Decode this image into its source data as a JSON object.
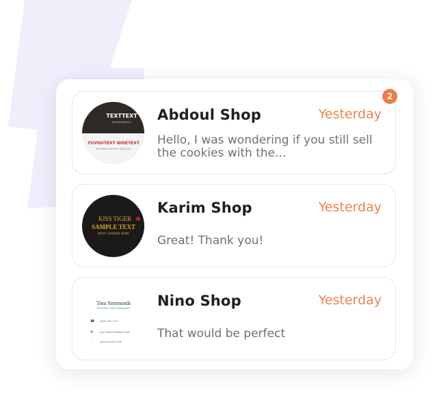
{
  "conversations": [
    {
      "name": "Abdoul Shop",
      "time": "Yesterday",
      "message": "Hello, I was wondering if you still sell the cookies with the...",
      "avatar": {
        "line1": "TEXTTEXT",
        "line2": "WHATEVERTEXT",
        "line3": "YUVOUTEXT NIDETEXT",
        "line4": "INFORMATIONTEXT NIDETEXT"
      }
    },
    {
      "name": "Karim Shop",
      "time": "Yesterday",
      "message": "Great! Thank you!",
      "avatar": {
        "line1": "KISS TIGER",
        "line2": "SAMPLE TEXT",
        "line3": "INPUT COMPANY NAME"
      }
    },
    {
      "name": "Nino Shop",
      "time": "Yesterday",
      "message": "That would be perfect",
      "avatar": {
        "name": "Tina Simmonds",
        "title": "REGIONAL SALES MANAGER",
        "phone": "(801) 452-1771",
        "email": "tina.simmonds@site.com",
        "web": "www.yoursite.com"
      }
    }
  ],
  "unread_badge": "2",
  "colors": {
    "accent": "#ef7b46",
    "timestamp": "#ef8350",
    "bolt_background": "#efeffc"
  }
}
